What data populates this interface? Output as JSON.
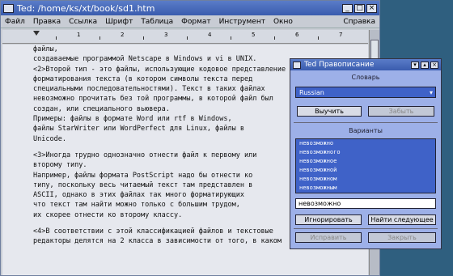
{
  "window": {
    "title": "Ted: /home/ks/xt/book/sd1.htm",
    "controls": [
      "minimize",
      "maximize",
      "close"
    ]
  },
  "menubar": {
    "items": [
      "Файл",
      "Правка",
      "Ссылка",
      "Шрифт",
      "Таблица",
      "Формат",
      "Инструмент",
      "Окно"
    ],
    "help": "Справка"
  },
  "ruler": {
    "numbers": [
      "1",
      "2",
      "3",
      "4",
      "5",
      "6",
      "7",
      "8"
    ]
  },
  "document": {
    "lines": [
      "файлы,",
      "создаваемые программой Netscape в Windows и vi в UNIX.",
      "<2>Второй тип - это файлы, использующие кодовое представление",
      "форматирования текста (в котором символы текста перед",
      "специальными последовательностями). Текст в таких файлах",
      "невозможно прочитать без той программы, в которой файл был",
      "создан, или специального вьювера.",
      "Примеры: файлы в формате Word или rtf в Windows,",
      "файлы StarWriter или WordPerfect для Linux, файлы в",
      "Unicode.",
      "",
      "<3>Иногда трудно однозначно отнести файл к первому или",
      "второму типу.",
      "Например, файлы формата PostScript надо бы отнести ко",
      "типу, поскольку весь читаемый текст там представлен в",
      "ASCII, однако в этих файлах так много форматирующих",
      "что текст там найти можно только с большим трудом,",
      "их скорее отнести ко второму классу.",
      "",
      "<4>В соответствии с этой классификацией файлов и текстовые",
      "редакторы делятся на 2 класса в зависимости от того, в каком"
    ]
  },
  "spell_dialog": {
    "title": "Ted Правописание",
    "dictionary_label": "Словарь",
    "dictionary_value": "Russian",
    "learn_button": "Выучить",
    "forget_button": "Забыть",
    "suggestions_label": "Варианты",
    "suggestions": [
      "невозможно",
      "невозможного",
      "невозможное",
      "невозможной",
      "невозможном",
      "невозможным",
      "невозможных"
    ],
    "word_input": "невозможно",
    "ignore_button": "Игнорировать",
    "find_next_button": "Найти следующее",
    "correct_button": "Исправить",
    "close_button": "Закрыть"
  }
}
